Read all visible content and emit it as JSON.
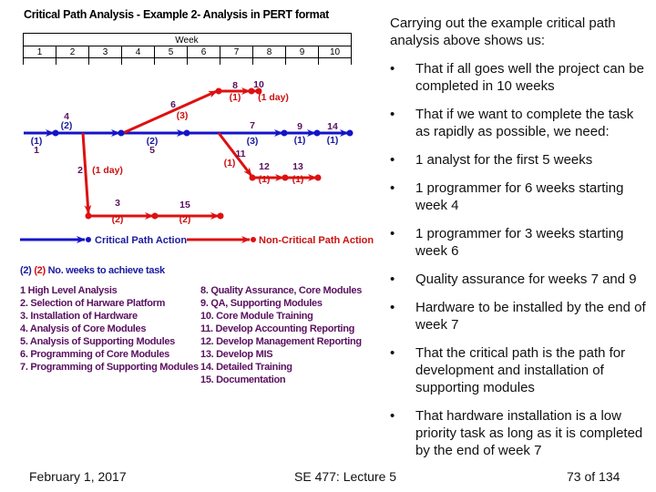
{
  "slide": {
    "title": "Critical Path Analysis - Example 2- Analysis in PERT format",
    "week_header": "Week",
    "weeks": [
      "1",
      "2",
      "3",
      "4",
      "5",
      "6",
      "7",
      "8",
      "9",
      "10"
    ]
  },
  "diagram": {
    "colors": {
      "critical": "#1414c8",
      "non_critical": "#dd1111",
      "label": "#5a1060"
    },
    "activities": [
      {
        "id": "1",
        "duration": "(1)",
        "critical": true
      },
      {
        "id": "4",
        "duration": "(2)",
        "critical": true
      },
      {
        "id": "5",
        "duration": "(2)",
        "critical": true
      },
      {
        "id": "7",
        "duration": "(3)",
        "critical": true
      },
      {
        "id": "9",
        "duration": "(1)",
        "critical": true
      },
      {
        "id": "14",
        "duration": "(1)",
        "critical": true
      },
      {
        "id": "6",
        "duration": "(3)",
        "critical": false
      },
      {
        "id": "8",
        "duration": "(1)",
        "critical": false
      },
      {
        "id": "10",
        "duration": "(1 day)",
        "critical": false
      },
      {
        "id": "11",
        "duration": "(1)",
        "critical": false
      },
      {
        "id": "12",
        "duration": "(1)",
        "critical": false
      },
      {
        "id": "13",
        "duration": "(1)",
        "critical": false
      },
      {
        "id": "2",
        "duration": "(1 day)",
        "critical": false
      },
      {
        "id": "3",
        "duration": "(2)",
        "critical": false
      },
      {
        "id": "15",
        "duration": "(2)",
        "critical": false
      }
    ],
    "legend": {
      "critical": "Critical Path Action",
      "non_critical": "Non-Critical Path Action",
      "key_blue": "(2)",
      "key_red": "(2)",
      "key_text": "No. weeks to achieve task"
    }
  },
  "tasks_left": [
    "1 High Level Analysis",
    "2. Selection of Harware Platform",
    "3. Installation of Hardware",
    "4. Analysis of Core Modules",
    "5. Analysis of Supporting Modules",
    "6. Programming of Core Modules",
    "7. Programming of Supporting Modules"
  ],
  "tasks_right": [
    "8. Quality Assurance, Core Modules",
    "9. QA, Supporting Modules",
    "10. Core Module Training",
    "11. Develop Accounting Reporting",
    "12. Develop Management Reporting",
    "13. Develop MIS",
    "14. Detailed Training",
    "15. Documentation"
  ],
  "notes": {
    "intro": "Carrying out the example critical path analysis above shows us:",
    "bullets": [
      "That if all goes well the project can be completed in 10 weeks",
      "That if we want to complete the task as rapidly as possible, we need:",
      "1 analyst for the first 5 weeks",
      "1 programmer for 6 weeks starting week 4",
      "1 programmer for 3 weeks starting week 6",
      "Quality assurance for weeks 7 and 9",
      "Hardware to be installed by the end of week 7",
      "That the critical path is the path for development and installation of supporting modules",
      "That hardware installation is a low priority task as long as it is completed by the end of week 7"
    ],
    "bullet_glyph": "•"
  },
  "footer": {
    "date": "February 1, 2017",
    "course": "SE 477: Lecture 5",
    "page": "73 of 134"
  }
}
